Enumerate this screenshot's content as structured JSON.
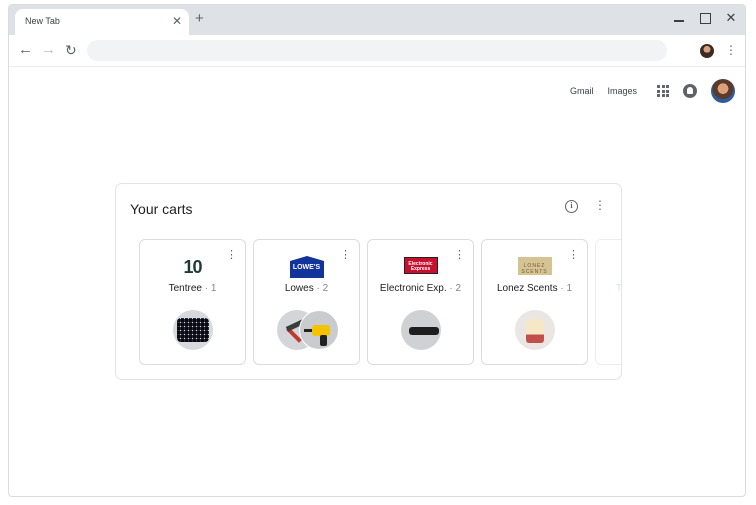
{
  "browser": {
    "tab_title": "New Tab",
    "tab_close_glyph": "✕",
    "new_tab_glyph": "+",
    "window_close_glyph": "✕",
    "address_value": "",
    "nav_back_glyph": "←",
    "nav_forward_glyph": "→",
    "nav_reload_glyph": "↻",
    "menu_glyph": "⋮"
  },
  "ntp_header": {
    "gmail_label": "Gmail",
    "images_label": "Images"
  },
  "carts_module": {
    "title": "Your carts",
    "info_glyph": "i",
    "menu_glyph": "⋮",
    "carts": [
      {
        "merchant": "Tentree",
        "count": "· 1",
        "logo_text": "10",
        "icon": "shirt"
      },
      {
        "merchant": "Lowes",
        "count": "· 2",
        "logo_text": "LOWE'S",
        "icon": "hammer-drill"
      },
      {
        "merchant": "Electronic Exp.",
        "count": "· 2",
        "logo_text": "Electronic Express",
        "icon": "soundbar"
      },
      {
        "merchant": "Lonez Scents",
        "count": "· 1",
        "logo_text": "LONEZ SCENTS",
        "icon": "candle"
      },
      {
        "merchant": "Ta",
        "count": "",
        "logo_text": "",
        "icon": ""
      }
    ]
  },
  "colors": {
    "tabstrip": "#dee1e6",
    "lowes_blue": "#12339b",
    "ee_red": "#c8102e",
    "lonez_gold": "#d6c393",
    "tentree_green": "#1f3a34"
  }
}
